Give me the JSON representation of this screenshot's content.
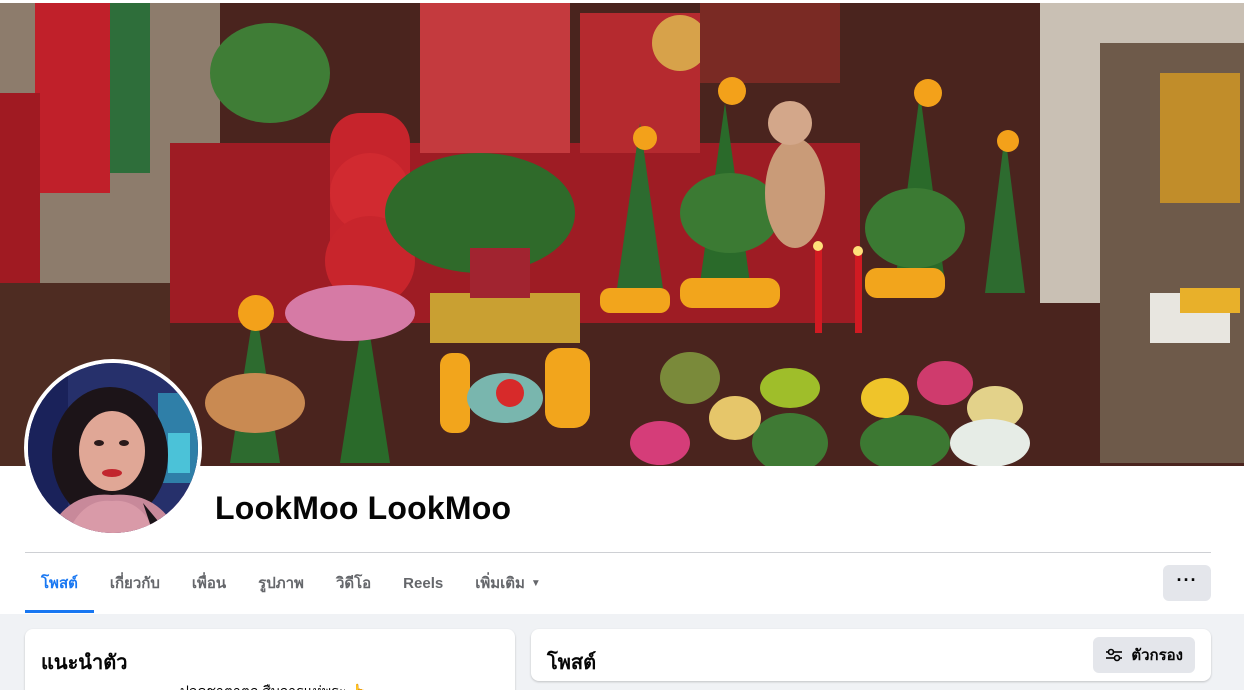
{
  "profile": {
    "name": "LookMoo LookMoo"
  },
  "nav": {
    "tabs": [
      {
        "label": "โพสต์",
        "active": true
      },
      {
        "label": "เกี่ยวกับ"
      },
      {
        "label": "เพื่อน"
      },
      {
        "label": "รูปภาพ"
      },
      {
        "label": "วิดีโอ"
      },
      {
        "label": "Reels"
      },
      {
        "label": "เพิ่มเติม"
      }
    ],
    "more_icon": "more-horizontal-icon",
    "more_label": "···"
  },
  "intro": {
    "title": "แนะนำตัว",
    "text": "ปลดชาตาตก สืบการแห่พระ 👆"
  },
  "posts": {
    "title": "โพสต์",
    "filter_label": "ตัวกรอง",
    "filter_icon": "filter-sliders-icon"
  },
  "colors": {
    "accent": "#1877f2",
    "page_bg": "#f0f2f5",
    "button_bg": "#e4e6eb"
  }
}
